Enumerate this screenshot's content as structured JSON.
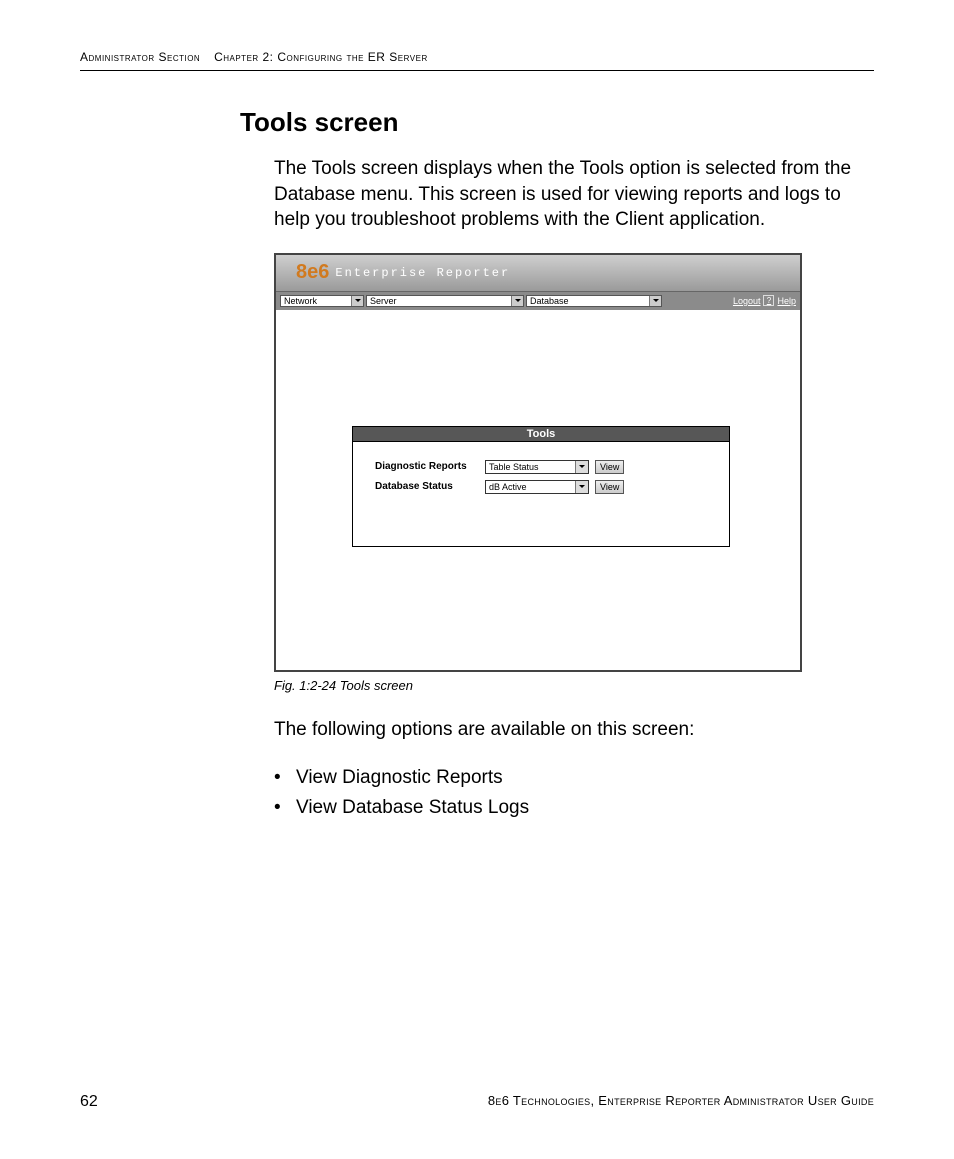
{
  "header": {
    "section": "Administrator Section",
    "chapter": "Chapter 2: Configuring the ER Server"
  },
  "title": "Tools screen",
  "intro": "The Tools screen displays when the Tools option is selected from the Database menu. This screen is used for viewing reports and logs to help you troubleshoot problems with the Client application.",
  "figure": {
    "brand_logo": "8e6",
    "brand_text": "Enterprise Reporter",
    "menus": {
      "m0": "Network",
      "m1": "Server",
      "m2": "Database"
    },
    "links": {
      "logout": "Logout",
      "qmark": "?",
      "help": "Help"
    },
    "panel": {
      "title": "Tools",
      "row1_label": "Diagnostic Reports",
      "row1_value": "Table Status",
      "row2_label": "Database Status",
      "row2_value": "dB Active",
      "view_btn": "View"
    },
    "caption": "Fig. 1:2-24  Tools screen"
  },
  "after_fig": "The following options are available on this screen:",
  "options": {
    "o0": "View Diagnostic Reports",
    "o1": "View Database Status Logs"
  },
  "footer": {
    "page": "62",
    "text": "8e6 Technologies, Enterprise Reporter Administrator User Guide"
  }
}
